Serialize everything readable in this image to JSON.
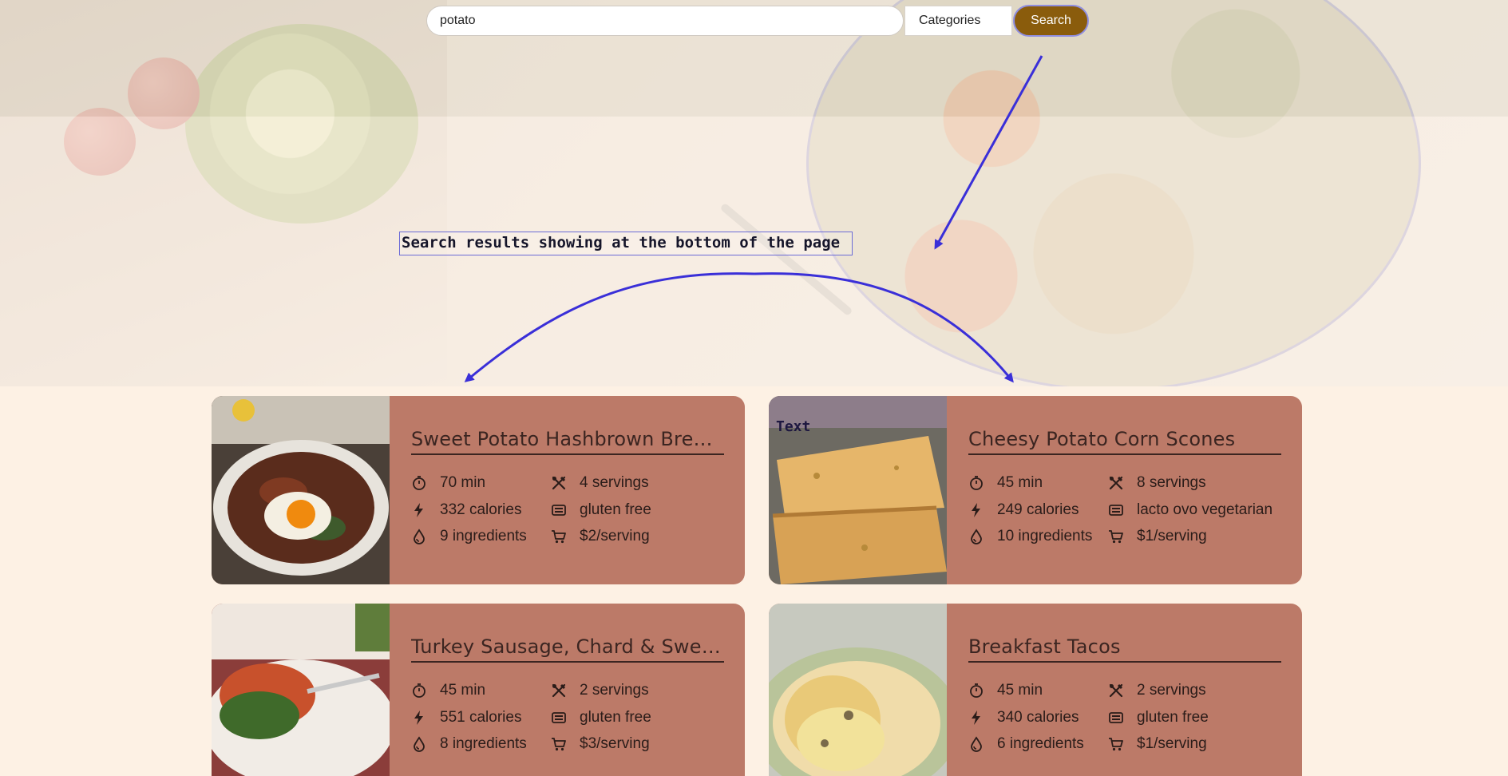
{
  "search": {
    "query": "potato",
    "category_label": "Categories",
    "button_label": "Search"
  },
  "annotation": {
    "label": "Search results showing at the bottom of the page",
    "image_tag": "Text"
  },
  "colors": {
    "page_bg": "#fdf1e4",
    "card_bg": "#bc7a68",
    "search_button": "#8a5c0c",
    "annotation_stroke": "#3a2fd8"
  },
  "recipes": [
    {
      "title": "Sweet Potato Hashbrown Break...",
      "time": "70 min",
      "servings": "4 servings",
      "calories": "332 calories",
      "diet": "gluten free",
      "ingredients": "9 ingredients",
      "price": "$2/serving",
      "image": "baked-egg-dish"
    },
    {
      "title": "Cheesy Potato Corn Scones",
      "time": "45 min",
      "servings": "8 servings",
      "calories": "249 calories",
      "diet": "lacto ovo vegetarian",
      "ingredients": "10 ingredients",
      "price": "$1/serving",
      "image": "scones"
    },
    {
      "title": "Turkey Sausage, Chard & Sweet...",
      "time": "45 min",
      "servings": "2 servings",
      "calories": "551 calories",
      "diet": "gluten free",
      "ingredients": "8 ingredients",
      "price": "$3/serving",
      "image": "sausage-plate"
    },
    {
      "title": "Breakfast Tacos",
      "time": "45 min",
      "servings": "2 servings",
      "calories": "340 calories",
      "diet": "gluten free",
      "ingredients": "6 ingredients",
      "price": "$1/serving",
      "image": "tacos"
    }
  ],
  "icons": {
    "time": "timer-icon",
    "servings": "utensils-icon",
    "calories": "lightning-icon",
    "diet": "diet-icon",
    "ingredients": "drop-icon",
    "price": "cart-icon"
  }
}
